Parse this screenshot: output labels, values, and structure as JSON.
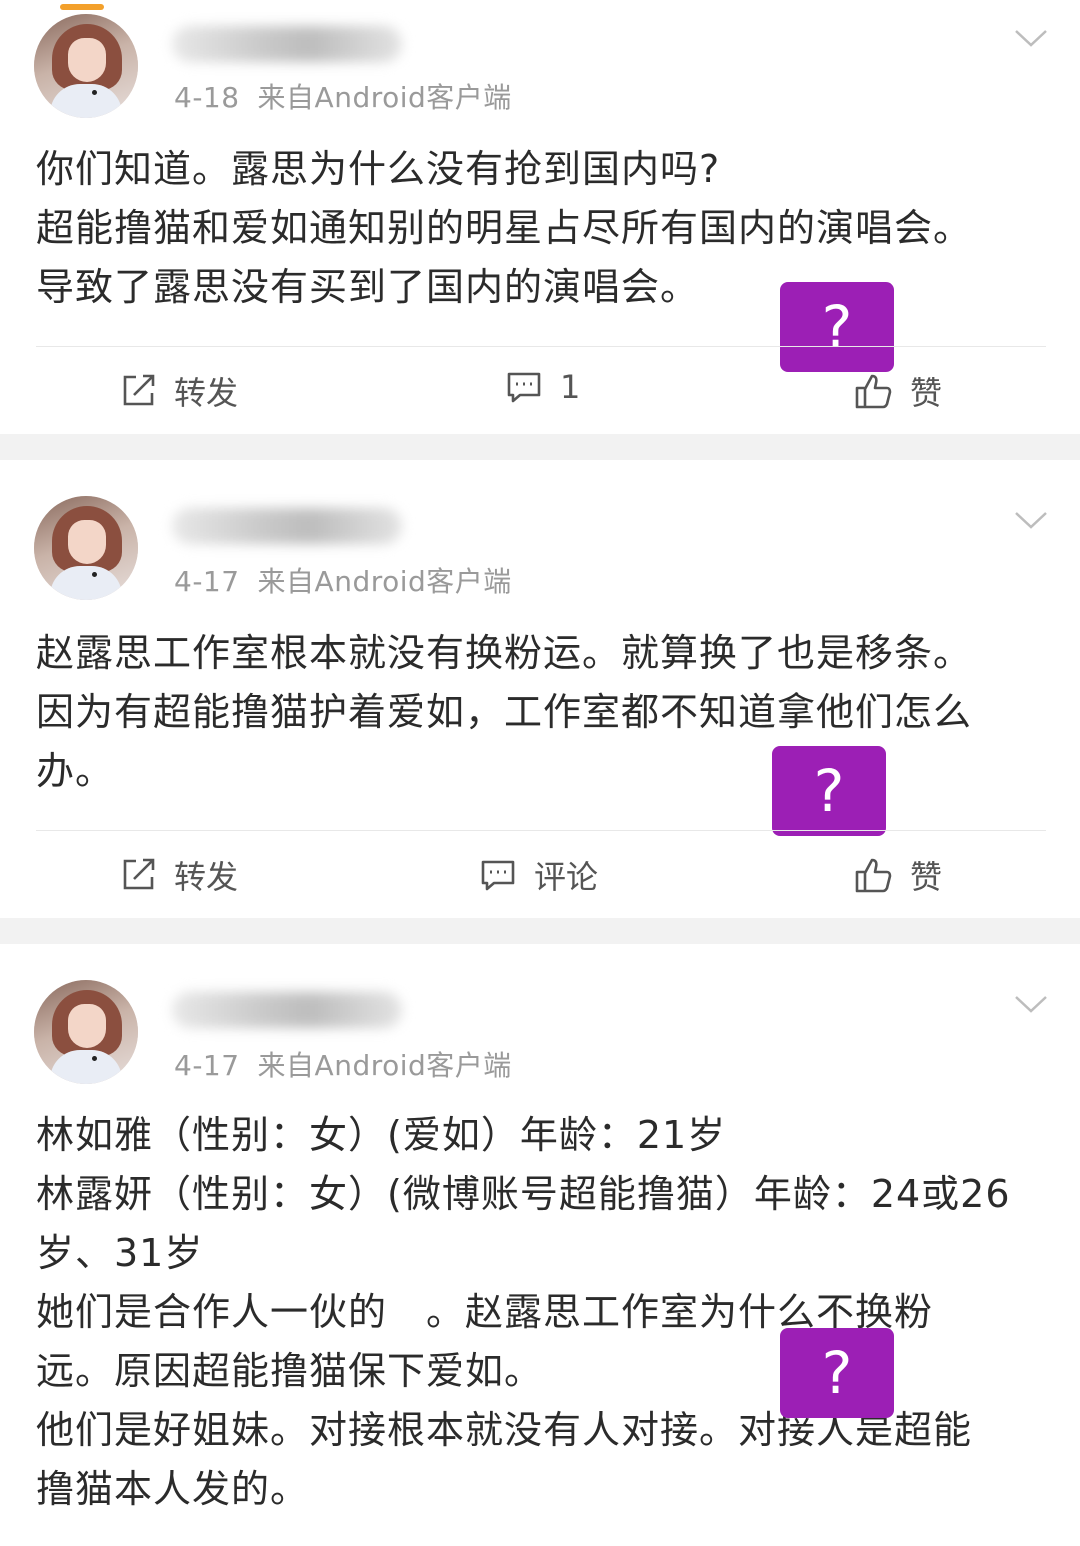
{
  "colors": {
    "placeholder_box": "#9c1fb5",
    "accent": "#f3a02b",
    "background": "#f2f2f2"
  },
  "posts": [
    {
      "date": "4-18",
      "source": "来自Android客户端",
      "lines": [
        "你们知道。露思为什么没有抢到国内吗?",
        "超能撸猫和爱如通知别的明星占尽所有国内的演唱会。",
        "导致了露思没有买到了国内的演唱会。"
      ],
      "actions": {
        "repost": "转发",
        "comment": "1",
        "like": "赞"
      },
      "placeholder": "?"
    },
    {
      "date": "4-17",
      "source": "来自Android客户端",
      "lines": [
        "赵露思工作室根本就没有换粉运。就算换了也是移条。",
        "因为有超能撸猫护着爱如，工作室都不知道拿他们怎么",
        "办。"
      ],
      "actions": {
        "repost": "转发",
        "comment": "评论",
        "like": "赞"
      },
      "placeholder": "?"
    },
    {
      "date": "4-17",
      "source": "来自Android客户端",
      "lines": [
        "林如雅（性别：女）(爱如）年龄：21岁",
        "林露妍（性别：女）(微博账号超能撸猫）年龄：24或26",
        "岁、31岁",
        "她们是合作人一伙的　。赵露思工作室为什么不换粉",
        "远。原因超能撸猫保下爱如。",
        "他们是好姐妹。对接根本就没有人对接。对接人是超能",
        "撸猫本人发的。"
      ],
      "placeholder": "?"
    }
  ]
}
